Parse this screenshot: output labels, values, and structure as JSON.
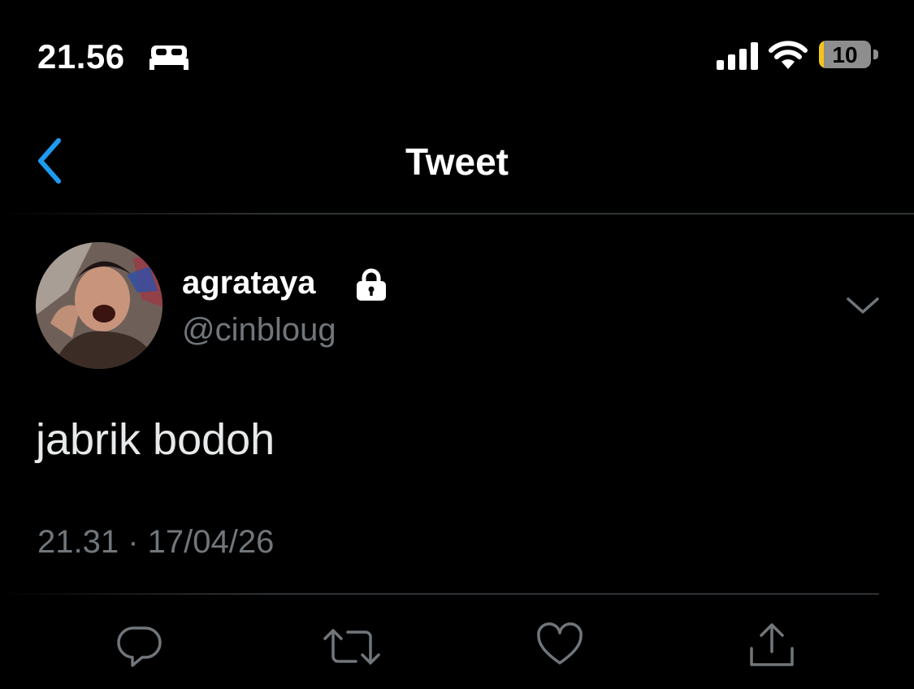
{
  "status_bar": {
    "time": "21.56",
    "battery_level": "10",
    "battery_fraction": 0.1,
    "battery_color": "#f5c518",
    "icons": [
      "bed-icon",
      "signal-icon",
      "wifi-icon",
      "battery-icon"
    ]
  },
  "nav": {
    "title": "Tweet",
    "back_icon": "chevron-left-icon",
    "accent_color": "#1d9bf0"
  },
  "tweet": {
    "display_name": "agrataya",
    "protected_icon": "lock-icon",
    "handle": "@cinbloug",
    "text": "jabrik bodoh",
    "timestamp": "21.31 · 17/04/26"
  },
  "actions": [
    {
      "name": "reply",
      "icon": "reply-icon"
    },
    {
      "name": "retweet",
      "icon": "retweet-icon"
    },
    {
      "name": "like",
      "icon": "heart-icon"
    },
    {
      "name": "share",
      "icon": "share-icon"
    }
  ]
}
